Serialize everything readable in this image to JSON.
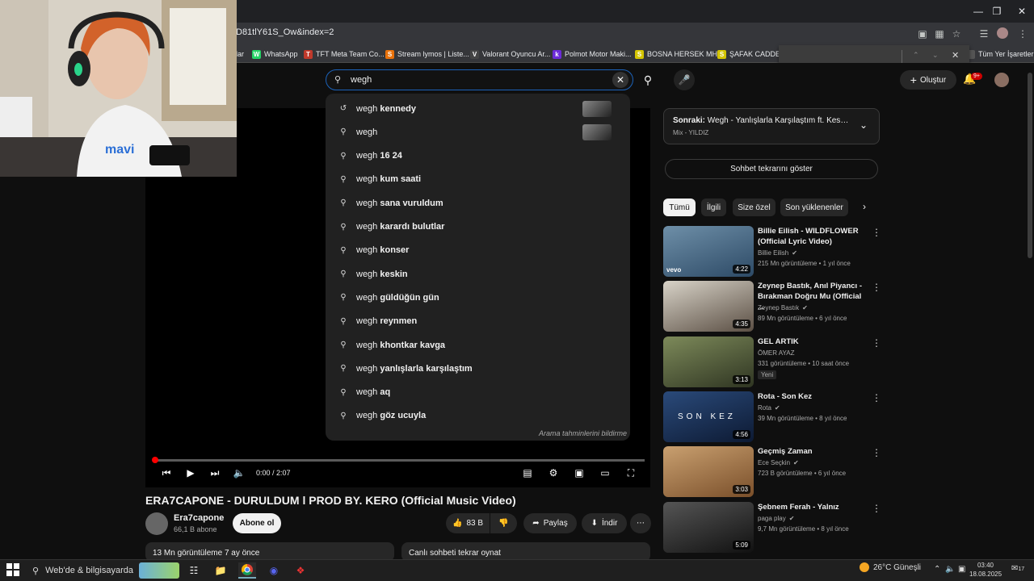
{
  "browser": {
    "url": "D81tlY61S_Ow&index=2",
    "bookmarks": [
      {
        "label": "lar",
        "icon": "",
        "color": "#35363a"
      },
      {
        "label": "WhatsApp",
        "icon": "W",
        "color": "#25d366"
      },
      {
        "label": "TFT Meta Team Co...",
        "icon": "T",
        "color": "#c0392b"
      },
      {
        "label": "Stream lymos | Liste...",
        "icon": "S",
        "color": "#e8710a"
      },
      {
        "label": "Valorant Oyuncu Ar...",
        "icon": "V",
        "color": "#444444"
      },
      {
        "label": "Polmot Motor Maki...",
        "icon": "k",
        "color": "#6c2bd9"
      },
      {
        "label": "BOSNA HERSEK MH...",
        "icon": "S",
        "color": "#d4c400"
      },
      {
        "label": "ŞAFAK CADDESİ N...",
        "icon": "S",
        "color": "#d4c400"
      }
    ],
    "all_bookmarks": "Tüm Yer İşaretleri"
  },
  "header": {
    "search_value": "wegh",
    "create_label": "Oluştur",
    "notif_badge": "9+"
  },
  "suggestions": [
    {
      "prefix": "wegh",
      "rest": " kennedy",
      "icon": "history",
      "thumb": true
    },
    {
      "prefix": "wegh",
      "rest": "",
      "icon": "search",
      "thumb": true
    },
    {
      "prefix": "wegh",
      "rest": " 16 24",
      "icon": "search",
      "thumb": false
    },
    {
      "prefix": "wegh",
      "rest": " kum saati",
      "icon": "search",
      "thumb": false
    },
    {
      "prefix": "wegh",
      "rest": " sana vuruldum",
      "icon": "search",
      "thumb": false
    },
    {
      "prefix": "wegh",
      "rest": " karardı bulutlar",
      "icon": "search",
      "thumb": false
    },
    {
      "prefix": "wegh",
      "rest": " konser",
      "icon": "search",
      "thumb": false
    },
    {
      "prefix": "wegh",
      "rest": " keskin",
      "icon": "search",
      "thumb": false
    },
    {
      "prefix": "wegh",
      "rest": " güldüğün gün",
      "icon": "search",
      "thumb": false
    },
    {
      "prefix": "wegh",
      "rest": " reynmen",
      "icon": "search",
      "thumb": false
    },
    {
      "prefix": "wegh",
      "rest": " khontkar kavga",
      "icon": "search",
      "thumb": false
    },
    {
      "prefix": "wegh",
      "rest": " yanlışlarla karşılaştım",
      "icon": "search",
      "thumb": false
    },
    {
      "prefix": "wegh",
      "rest": " aq",
      "icon": "search",
      "thumb": false
    },
    {
      "prefix": "wegh",
      "rest": " göz ucuyla",
      "icon": "search",
      "thumb": false
    }
  ],
  "report_label": "Arama tahminlerini bildirme",
  "player": {
    "time": "0:00 / 2:07",
    "progress": 0.0
  },
  "video": {
    "title": "ERA7CAPONE - DURULDUM l PROD BY. KERO (Official Music Video)",
    "channel": "Era7capone",
    "subs": "66,1 B abone",
    "subscribe": "Abone ol",
    "likes": "83 B",
    "share": "Paylaş",
    "download": "İndir",
    "views": "13 Mn görüntüleme  7 ay önce",
    "replay": "Canlı sohbeti tekrar oynat"
  },
  "sidebar": {
    "next_label": "Sonraki:",
    "next_title": "Wegh - Yanlışlarla Karşılaştım ft. Keskin (O...",
    "next_sub": "Mix - YILDIZ",
    "chat_btn": "Sohbet tekrarını göster",
    "chips": [
      "Tümü",
      "İlgili",
      "Size özel",
      "Son yüklenenler"
    ],
    "videos": [
      {
        "title": "Billie Eilish - WILDFLOWER (Official Lyric Video)",
        "channel": "Billie Eilish",
        "meta": "215 Mn görüntüleme • 1 yıl önce",
        "duration": "4:22",
        "verified": true,
        "new": false,
        "c1": "#6e8fa8",
        "c2": "#2d4a66"
      },
      {
        "title": "Zeynep Bastık, Anıl Piyancı - Bırakman Doğru Mu (Official ...",
        "channel": "Zeynep Bastık",
        "meta": "89 Mn görüntüleme • 6 yıl önce",
        "duration": "4:35",
        "verified": true,
        "new": false,
        "c1": "#d8d3c8",
        "c2": "#5b4f44"
      },
      {
        "title": "GEL ARTIK",
        "channel": "ÖMER AYAZ",
        "meta": "331 görüntüleme • 10 saat önce",
        "duration": "3:13",
        "verified": false,
        "new": true,
        "c1": "#7d8a5a",
        "c2": "#2f3522"
      },
      {
        "title": "Rota - Son Kez",
        "channel": "Rota",
        "meta": "39 Mn görüntüleme • 8 yıl önce",
        "duration": "4:56",
        "verified": true,
        "new": false,
        "c1": "#2a4a7a",
        "c2": "#0d1a33"
      },
      {
        "title": "Geçmiş Zaman",
        "channel": "Ece Seçkin",
        "meta": "723 B görüntüleme • 6 yıl önce",
        "duration": "3:03",
        "verified": true,
        "new": false,
        "c1": "#c9a070",
        "c2": "#7a4f2a"
      },
      {
        "title": "Şebnem Ferah - Yalnız",
        "channel": "paga play",
        "meta": "9,7 Mn görüntüleme • 8 yıl önce",
        "duration": "5:09",
        "verified": true,
        "new": false,
        "c1": "#555555",
        "c2": "#111111"
      }
    ],
    "rota_overlay": "SON KEZ",
    "vevo": "vevo"
  },
  "taskbar": {
    "search": "Web'de & bilgisayarda",
    "weather": "26°C  Güneşli",
    "time": "03:40",
    "date": "18.08.2025",
    "notif": "17"
  },
  "colors": {
    "accent": "#1c62b9",
    "red": "#ff0000"
  }
}
